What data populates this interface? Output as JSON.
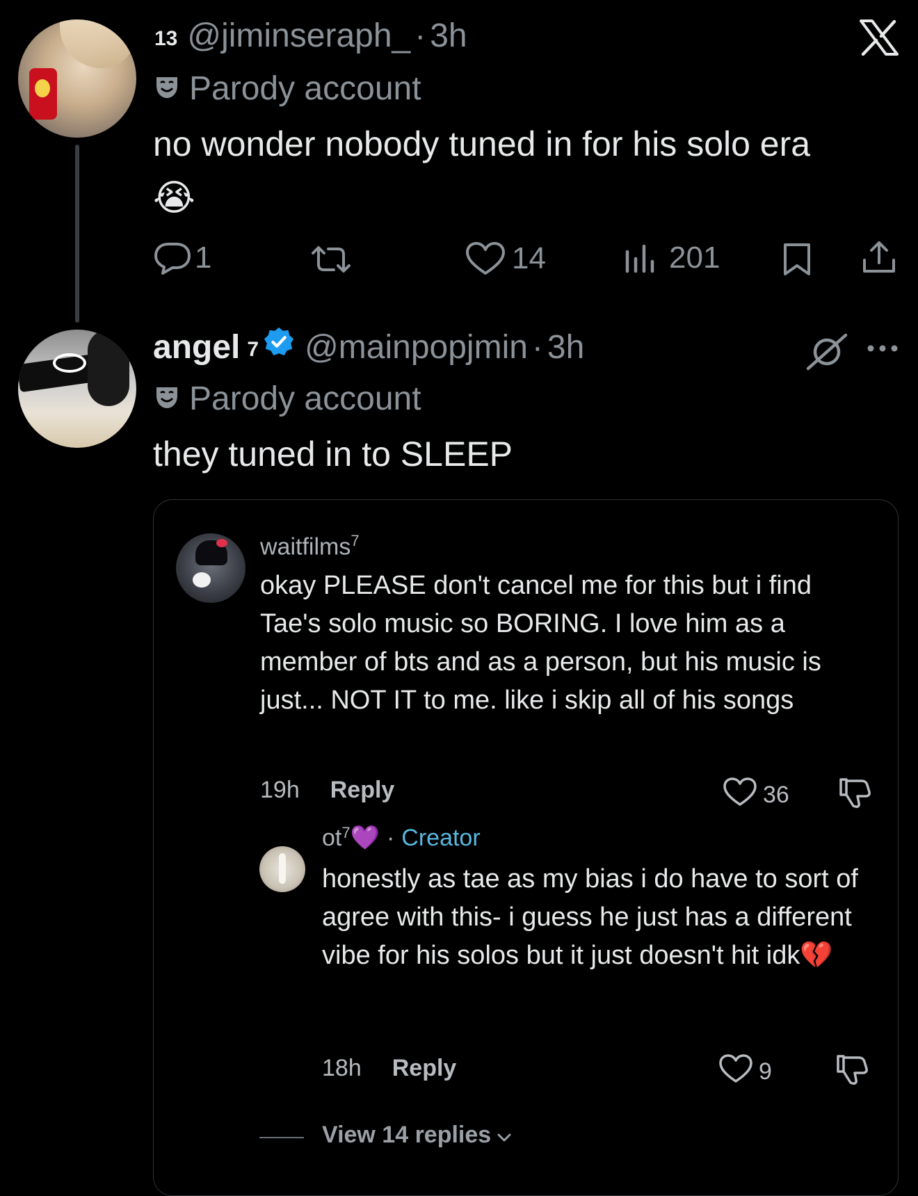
{
  "tweet1": {
    "count_badge": "13",
    "handle": "@jiminseraph_",
    "dot": "·",
    "time": "3h",
    "label": "Parody account",
    "text": "no wonder nobody tuned in for his solo era",
    "emoji": "😭",
    "actions": {
      "replies": "1",
      "retweets": "",
      "likes": "14",
      "views": "201"
    }
  },
  "tweet2": {
    "display_name": "angel",
    "superscript": "7",
    "handle": "@mainpopjmin",
    "dot": "·",
    "time": "3h",
    "label": "Parody account",
    "text": "they tuned in to SLEEP"
  },
  "quoted": {
    "comment1": {
      "username": "waitfilms",
      "superscript": "7",
      "text": "okay PLEASE don't cancel me for this but i find Tae's solo music so BORING. I love him as a member of bts and as a person, but his music is just... NOT IT to me. like i skip all of his songs",
      "time": "19h",
      "reply_label": "Reply",
      "likes": "36"
    },
    "comment2": {
      "username": "ot",
      "superscript": "7",
      "emoji": "💜",
      "separator": "·",
      "badge": "Creator",
      "text": "honestly as tae as my bias i do have to sort of agree with this- i guess he just has a different vibe for his solos but it just doesn't hit idk",
      "emoji_end": "💔",
      "time": "18h",
      "reply_label": "Reply",
      "likes": "9"
    },
    "view_replies": "View 14 replies"
  },
  "icons": {
    "app_logo": "x-logo-icon",
    "parody_mask": "theater-mask-icon",
    "reply": "speech-bubble-icon",
    "retweet": "retweet-icon",
    "like": "heart-icon",
    "views": "bar-chart-icon",
    "bookmark": "bookmark-icon",
    "share": "share-icon",
    "verified": "verified-badge-icon",
    "mute": "slashed-circle-icon",
    "more": "more-dots-icon",
    "dislike": "thumbs-down-icon",
    "chevron": "chevron-down-icon"
  },
  "colors": {
    "background": "#000000",
    "text": "#e7e9ea",
    "muted": "#8b9298",
    "verified": "#1d9bf0",
    "creator": "#58b8e0"
  }
}
